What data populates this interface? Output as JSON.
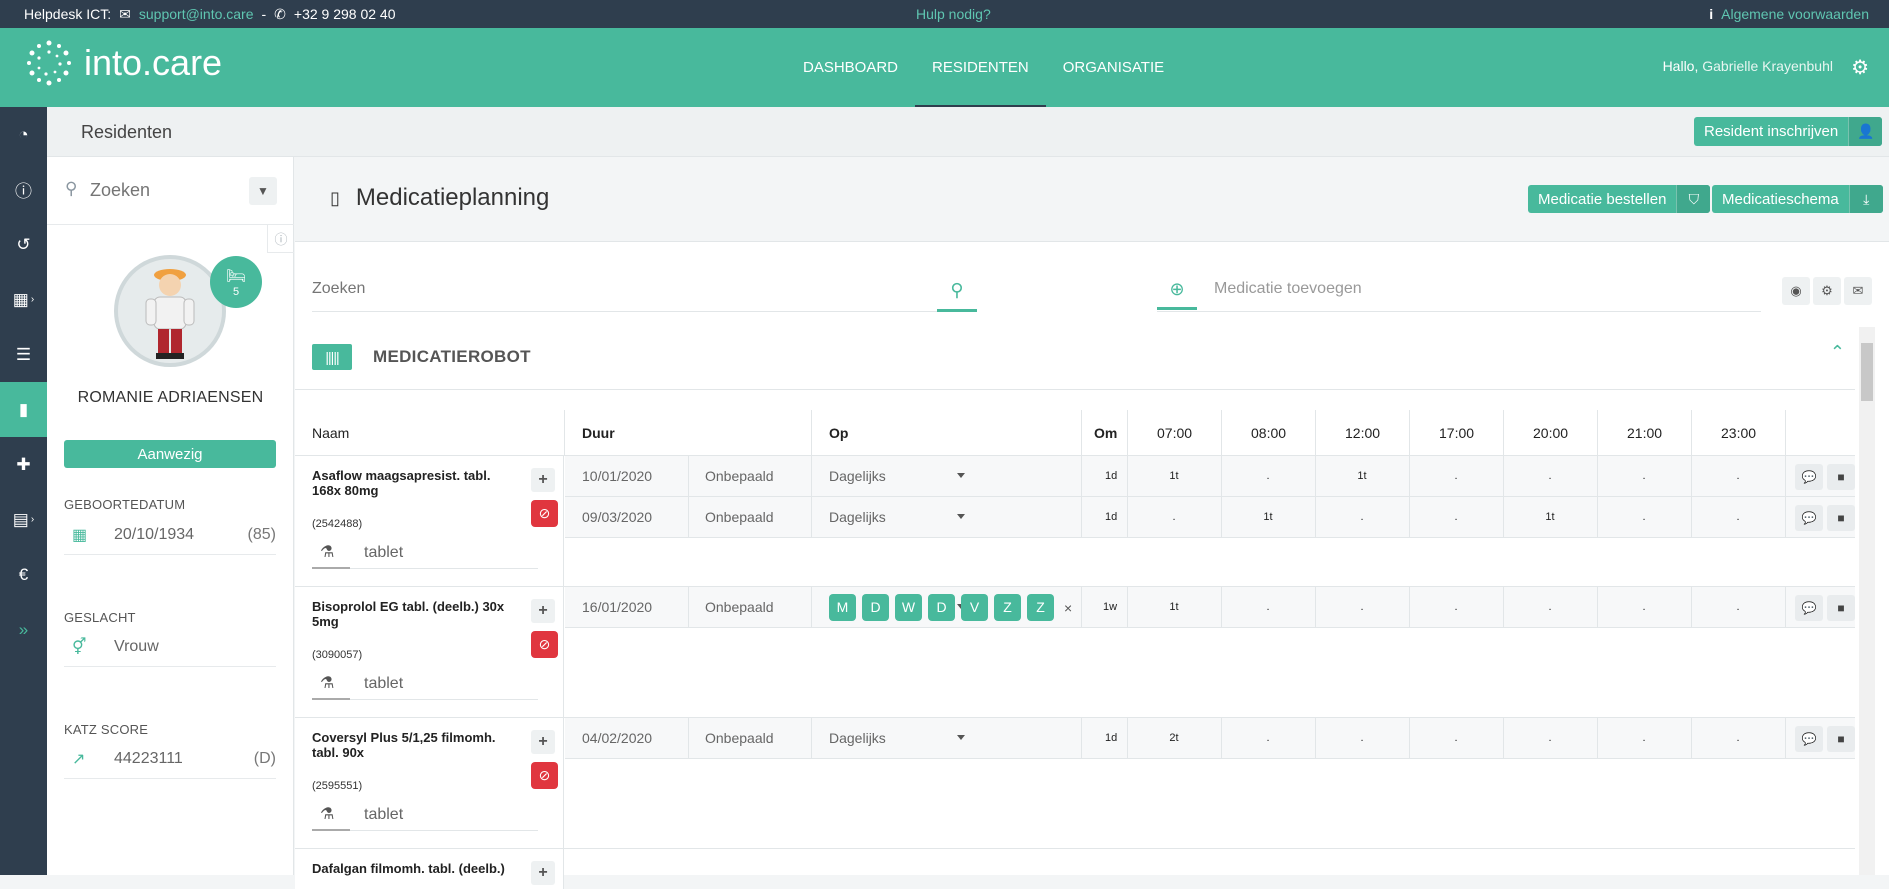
{
  "topbar": {
    "helpdesk_label": "Helpdesk ICT:",
    "email": "support@into.care",
    "dash": "-",
    "phone": "+32 9 298 02 40",
    "help": "Hulp nodig?",
    "terms": "Algemene voorwaarden"
  },
  "header": {
    "logo": "into.care",
    "nav": [
      "DASHBOARD",
      "RESIDENTEN",
      "ORGANISATIE"
    ],
    "hello": "Hallo,",
    "user": "Gabrielle Krayenbuhl"
  },
  "subheader": {
    "title": "Residenten",
    "register_button": "Resident inschrijven"
  },
  "resident": {
    "search_placeholder": "Zoeken",
    "bed_number": "5",
    "name": "ROMANIE ADRIAENSEN",
    "status": "Aanwezig",
    "birth_label": "GEBOORTEDATUM",
    "birth_date": "20/10/1934",
    "age": "(85)",
    "gender_label": "GESLACHT",
    "gender": "Vrouw",
    "katz_label": "KATZ SCORE",
    "katz": "44223111",
    "katz_class": "(D)"
  },
  "main": {
    "title": "Medicatieplanning",
    "order_button": "Medicatie bestellen",
    "schema_button": "Medicatieschema",
    "search_placeholder": "Zoeken",
    "add_placeholder": "Medicatie toevoegen",
    "section": "MEDICATIEROBOT"
  },
  "table": {
    "headers": {
      "naam": "Naam",
      "duur": "Duur",
      "op": "Op",
      "om": "Om",
      "times": [
        "07:00",
        "08:00",
        "12:00",
        "17:00",
        "20:00",
        "21:00",
        "23:00"
      ]
    },
    "meds": [
      {
        "name": "Asaflow maagsapresist. tabl. 168x 80mg",
        "code": "(2542488)",
        "form": "tablet",
        "lines": [
          {
            "start": "10/01/2020",
            "duration": "Onbepaald",
            "op": "Dagelijks",
            "om": "1d",
            "doses": [
              "1t",
              ".",
              "1t",
              ".",
              ".",
              ".",
              "."
            ]
          },
          {
            "start": "09/03/2020",
            "duration": "Onbepaald",
            "op": "Dagelijks",
            "om": "1d",
            "doses": [
              ".",
              "1t",
              ".",
              ".",
              "1t",
              ".",
              "."
            ]
          }
        ]
      },
      {
        "name": "Bisoprolol EG tabl. (deelb.) 30x 5mg",
        "code": "(3090057)",
        "form": "tablet",
        "lines": [
          {
            "start": "16/01/2020",
            "duration": "Onbepaald",
            "days": [
              "M",
              "D",
              "W",
              "D",
              "V",
              "Z",
              "Z"
            ],
            "days_clear": "×",
            "om": "1w",
            "doses": [
              "1t",
              ".",
              ".",
              ".",
              ".",
              ".",
              "."
            ]
          }
        ]
      },
      {
        "name": "Coversyl Plus 5/1,25 filmomh. tabl. 90x",
        "code": "(2595551)",
        "form": "tablet",
        "lines": [
          {
            "start": "04/02/2020",
            "duration": "Onbepaald",
            "op": "Dagelijks",
            "om": "1d",
            "doses": [
              "2t",
              ".",
              ".",
              ".",
              ".",
              ".",
              "."
            ]
          }
        ]
      },
      {
        "name": "Dafalgan filmomh. tabl. (deelb.)"
      }
    ]
  }
}
